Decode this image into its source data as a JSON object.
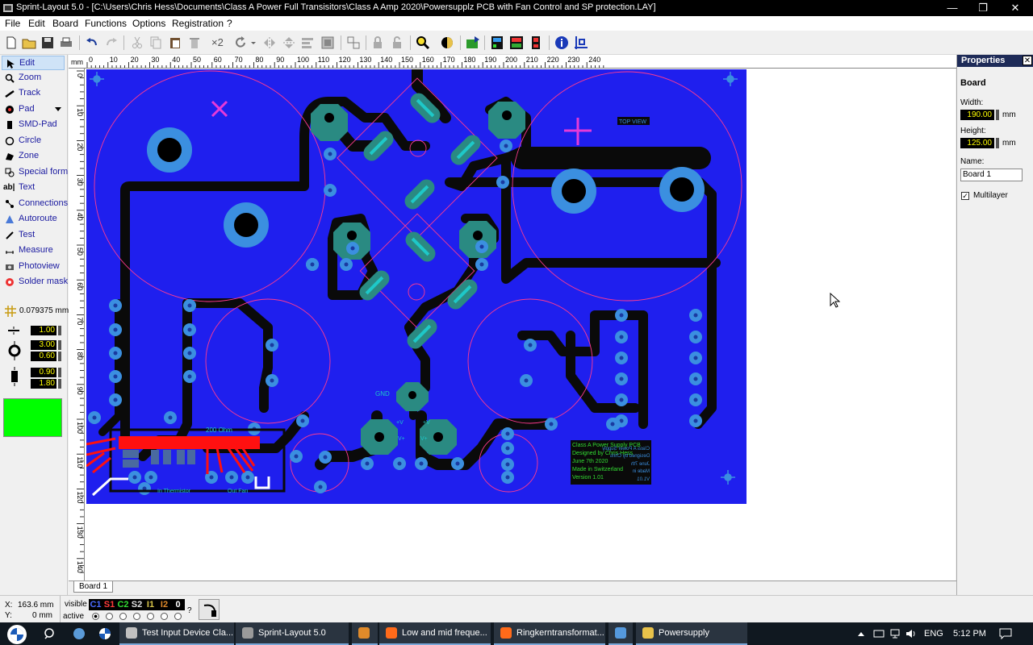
{
  "window": {
    "title": "Sprint-Layout 5.0 - [C:\\Users\\Chris Hess\\Documents\\Class A Power Full Transisitors\\Class A Amp 2020\\Powersupplz PCB with Fan Control and SP protection.LAY]",
    "controls": [
      "—",
      "❐",
      "✕"
    ]
  },
  "menu": [
    "File",
    "Edit",
    "Board",
    "Functions",
    "Options",
    "Registration",
    "?"
  ],
  "toolbar": {
    "icons": [
      "new-file",
      "open-folder",
      "save",
      "print",
      "undo",
      "redo",
      "cut",
      "copy",
      "paste",
      "delete",
      "duplicate",
      "rotate",
      "rotate-menu",
      "mirror-h",
      "mirror-v",
      "align",
      "group",
      "ungroup",
      "lock",
      "unlock",
      "zoom",
      "contrast",
      "component-tool",
      "drc",
      "gerber-export",
      "info",
      "grid-snap"
    ],
    "duplicate_label": "×2"
  },
  "tools": [
    {
      "label": "Edit",
      "icon": "pointer-icon"
    },
    {
      "label": "Zoom",
      "icon": "magnifier-icon"
    },
    {
      "label": "Track",
      "icon": "track-icon"
    },
    {
      "label": "Pad",
      "icon": "pad-icon"
    },
    {
      "label": "SMD-Pad",
      "icon": "smd-pad-icon"
    },
    {
      "label": "Circle",
      "icon": "circle-icon"
    },
    {
      "label": "Zone",
      "icon": "zone-icon"
    },
    {
      "label": "Special form",
      "icon": "special-form-icon"
    },
    {
      "label": "Text",
      "icon": "text-icon"
    },
    {
      "label": "Connections",
      "icon": "connections-icon"
    },
    {
      "label": "Autoroute",
      "icon": "autoroute-icon"
    },
    {
      "label": "Test",
      "icon": "test-icon"
    },
    {
      "label": "Measure",
      "icon": "measure-icon"
    },
    {
      "label": "Photoview",
      "icon": "photoview-icon"
    },
    {
      "label": "Solder mask",
      "icon": "solder-mask-icon"
    }
  ],
  "grid": {
    "value": "0.079375 mm"
  },
  "track_params": {
    "width": "1.00",
    "pad_outer": "3.00",
    "pad_inner": "0.60",
    "smd_w": "0.90",
    "smd_h": "1.80"
  },
  "current_color": "#00ff00",
  "ruler": {
    "unit": "mm",
    "top_ticks": [
      "0",
      "10",
      "20",
      "30",
      "40",
      "50",
      "60",
      "70",
      "80",
      "90",
      "100",
      "110",
      "120",
      "130",
      "140",
      "150",
      "160",
      "170",
      "180",
      "190",
      "200",
      "210",
      "220",
      "230",
      "240"
    ],
    "left_ticks": [
      "0",
      "10",
      "20",
      "30",
      "40",
      "50",
      "60",
      "70",
      "80",
      "90",
      "100",
      "110",
      "120",
      "130",
      "140"
    ]
  },
  "board_labels": {
    "top_view": "TOP VIEW",
    "gnd": "GND",
    "ohm": "200 Ohm",
    "thermistor": "In Thermistor",
    "out_fan": "Out Fan",
    "vplus1": "+V",
    "vplus2": "V+",
    "vplus3": "+V",
    "vplus4": "V+",
    "credits": [
      "Class A Power Supply PCB",
      "Designed by Chris Hess",
      "June 7th 2020",
      "Made in Switzerland",
      "Version 1.01"
    ],
    "credits_mirror": [
      "Class A Power Supply",
      "Designed by Chris",
      "June 7th",
      "Made in",
      "V1.01"
    ]
  },
  "colors": {
    "board": "#1f1fee",
    "copper_bottom": "#0a0a0a",
    "pad": "#3b8fe0",
    "pad_ring": "#2a8a82",
    "silk": "#1ec8c8",
    "outline": "#ff3a90",
    "mark": "#e53ad8",
    "smd": "#ff1010",
    "drill": "#000000"
  },
  "sheet_tab": "Board 1",
  "properties": {
    "title": "Properties",
    "section": "Board",
    "width_label": "Width:",
    "width_value": "190.00",
    "height_label": "Height:",
    "height_value": "125.00",
    "unit": "mm",
    "name_label": "Name:",
    "name_value": "Board 1",
    "multilayer_label": "Multilayer",
    "multilayer_checked": "✓"
  },
  "status": {
    "x_label": "X:",
    "x_value": "163.6 mm",
    "y_label": "Y:",
    "y_value": "0 mm",
    "visible_label": "visible",
    "active_label": "active",
    "layers": [
      {
        "name": "C1",
        "color": "#4a6aff"
      },
      {
        "name": "S1",
        "color": "#ff3b3b"
      },
      {
        "name": "C2",
        "color": "#33dd33"
      },
      {
        "name": "S2",
        "color": "#e0e0e0"
      },
      {
        "name": "I1",
        "color": "#d9c64a"
      },
      {
        "name": "I2",
        "color": "#e08a2a"
      },
      {
        "name": "0",
        "color": "#ffffff"
      }
    ],
    "help": "?"
  },
  "taskbar": {
    "items": [
      {
        "label": "Test Input Device Cla...",
        "color": "#c0c0c0"
      },
      {
        "label": "Sprint-Layout 5.0",
        "color": "#9a9a9a"
      },
      {
        "label": "",
        "color": "#e08a2a"
      },
      {
        "label": "Low and mid freque...",
        "color": "#ff6a1a"
      },
      {
        "label": "Ringkerntransformat...",
        "color": "#ff6a1a"
      },
      {
        "label": "",
        "color": "#5599dd"
      },
      {
        "label": "Powersupply",
        "color": "#e8c24a"
      }
    ],
    "lang": "ENG",
    "time": "5:12 PM"
  }
}
